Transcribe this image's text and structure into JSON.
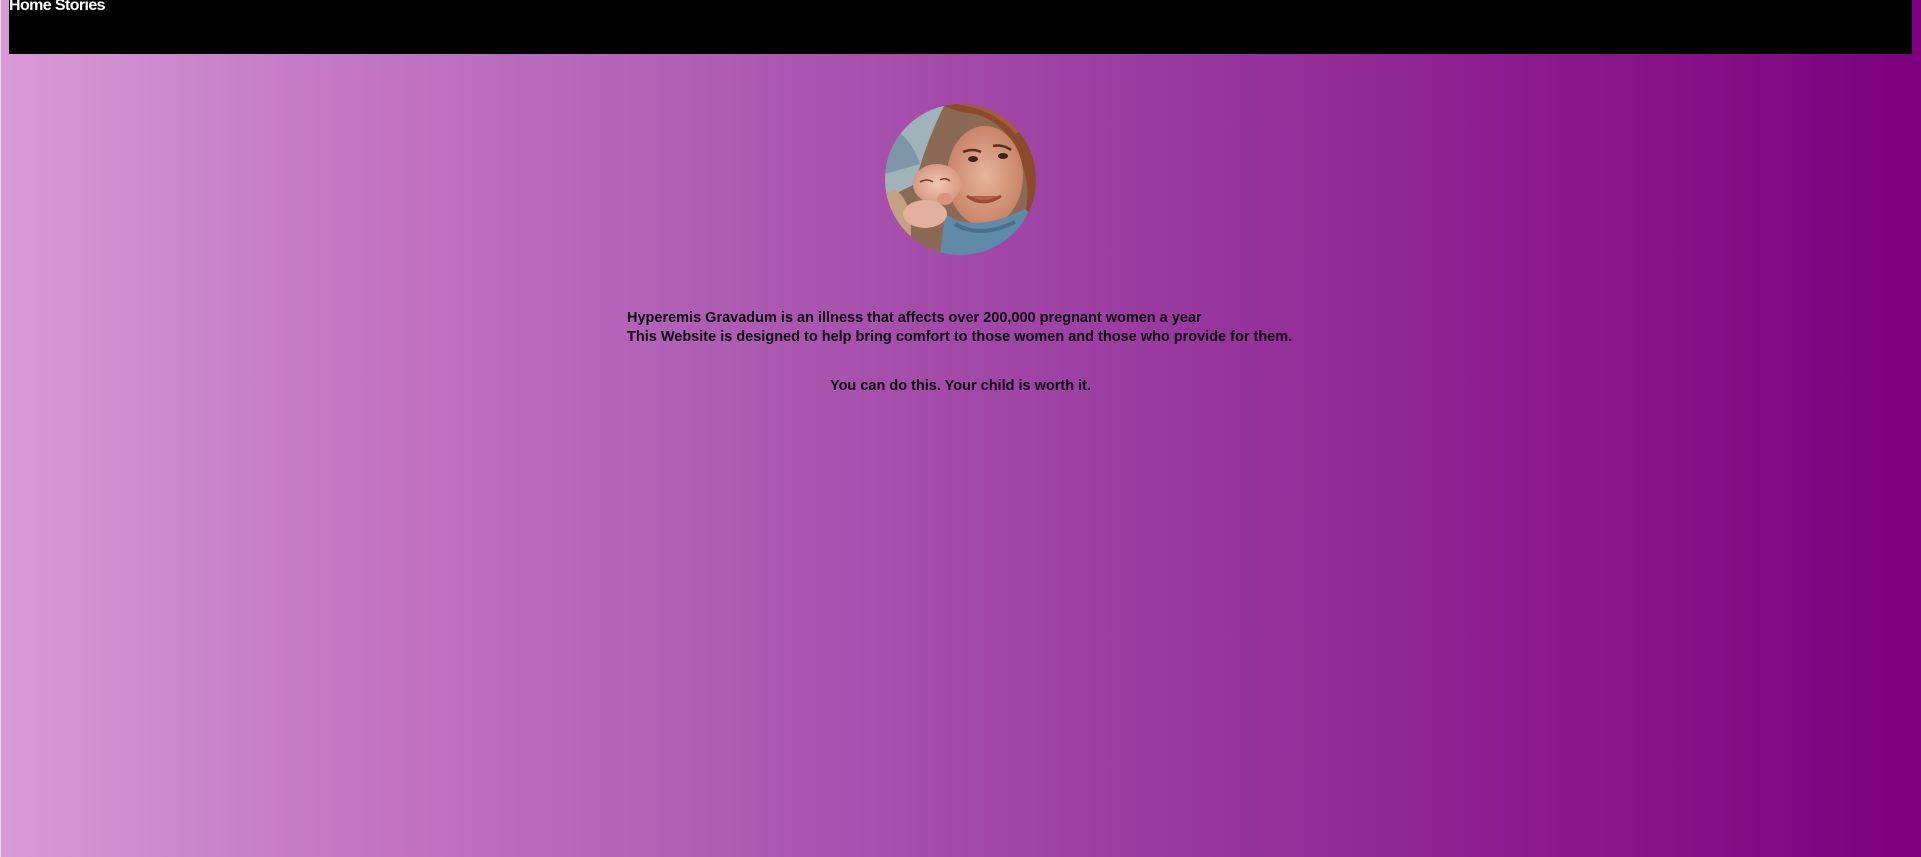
{
  "nav": {
    "home_label": "Home",
    "stories_label": "Stories"
  },
  "hero": {
    "image_icon": "mother-and-newborn-photo"
  },
  "intro": {
    "line1": "Hyperemis Gravadum is an illness that affects over 200,000 pregnant women a year",
    "line2": "This Website is designed to help bring comfort to those women and those who provide for them."
  },
  "tagline": "You can do this. Your child is worth it.",
  "colors": {
    "navbar": "#000000",
    "gradient_start": "#d99ad6",
    "gradient_end": "#7d007f",
    "text": "#0d0010"
  }
}
